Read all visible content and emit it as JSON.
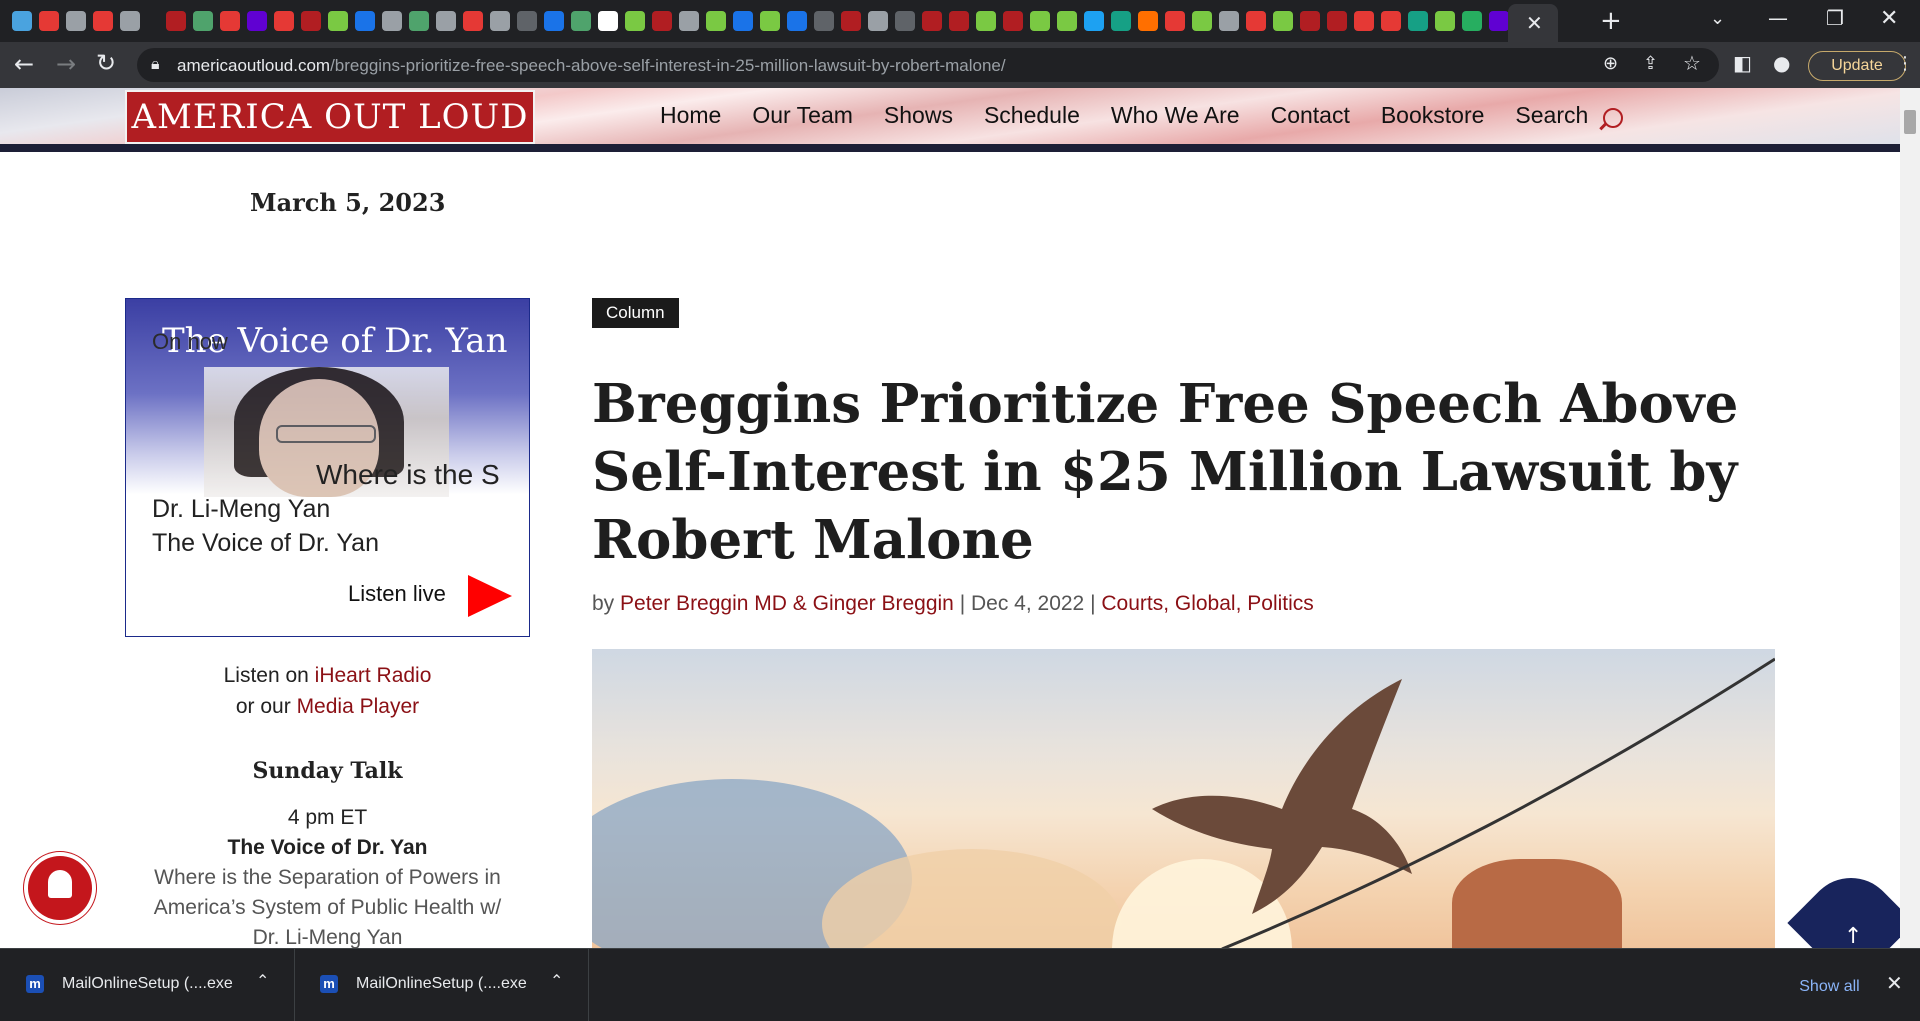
{
  "browser": {
    "tab_icon_colors": [
      "#4aa3df",
      "#e53935",
      "#9aa0a6",
      "#e53935",
      "#9aa0a6",
      "#b11e22",
      "#4fa36c",
      "#e53935",
      "#6001d2",
      "#e53935",
      "#b11e22",
      "#7ac943",
      "#1a73e8",
      "#9aa0a6",
      "#4fa36c",
      "#9aa0a6",
      "#e53935",
      "#9aa0a6",
      "#5f6368",
      "#1a73e8",
      "#4fa36c",
      "#ffffff",
      "#7ac943",
      "#b11e22",
      "#9aa0a6",
      "#7ac943",
      "#1a73e8",
      "#7ac943",
      "#1a73e8",
      "#5f6368",
      "#b11e22",
      "#9aa0a6",
      "#5f6368",
      "#b11e22",
      "#b11e22",
      "#7ac943",
      "#b11e22",
      "#7ac943",
      "#7ac943",
      "#1da1f2",
      "#16a085",
      "#ff6f00",
      "#e53935",
      "#7ac943",
      "#9aa0a6",
      "#e53935",
      "#7ac943",
      "#b11e22",
      "#b11e22",
      "#e53935",
      "#e53935",
      "#16a085",
      "#7ac943",
      "#27ae60",
      "#6001d2"
    ],
    "new_tab_icon": "plus-icon",
    "url_host": "americaoutloud.com",
    "url_path": "/breggins-prioritize-free-speech-above-self-interest-in-25-million-lawsuit-by-robert-malone/",
    "update_label": "Update"
  },
  "site": {
    "logo": "AMERICA OUT LOUD",
    "nav": [
      "Home",
      "Our Team",
      "Shows",
      "Schedule",
      "Who We Are",
      "Contact",
      "Bookstore",
      "Search"
    ],
    "date": "March 5, 2023"
  },
  "sidebar": {
    "widget_title": "The Voice of Dr. Yan",
    "on_now": "On now",
    "scroll_text": "Where is the S",
    "host": "Dr. Li-Meng Yan",
    "show": "The Voice of Dr. Yan",
    "listen_live": "Listen live",
    "listen_on": "Listen on",
    "iheart": "iHeart Radio",
    "or_our": "or our",
    "media_player": "Media Player",
    "sunday_title": "Sunday Talk",
    "time": "4 pm ET",
    "show_name": "The Voice of Dr. Yan",
    "desc_line1": "Where is the Separation of Powers in",
    "desc_line2": "America’s System of Public Health w/",
    "desc_line3": "Dr. Li-Meng Yan"
  },
  "article": {
    "category": "Column",
    "title": "Breggins Prioritize Free Speech Above Self-Interest in $25 Million Lawsuit by Robert Malone",
    "by": "by",
    "authors": "Peter Breggin MD & Ginger Breggin",
    "sep1": " | ",
    "date": "Dec 4, 2022",
    "sep2": " | ",
    "categories": "Courts, Global, Politics"
  },
  "downloads": {
    "items": [
      "MailOnlineSetup (....exe",
      "MailOnlineSetup (....exe"
    ],
    "show_all": "Show all"
  }
}
